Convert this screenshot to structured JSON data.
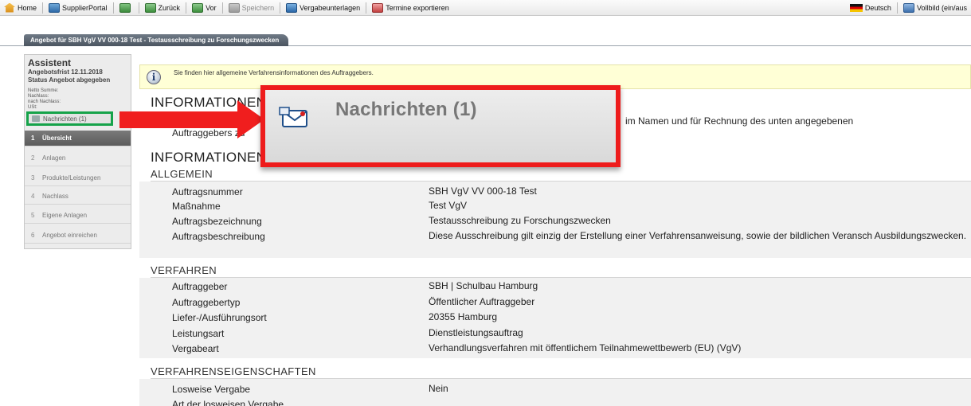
{
  "toolbar": {
    "home": "Home",
    "supplier_portal": "SupplierPortal",
    "back": "Zurück",
    "forward": "Vor",
    "save": "Speichern",
    "tender_documents": "Vergabeunterlagen",
    "export_dates": "Termine exportieren",
    "language": "Deutsch",
    "fullscreen": "Vollbild (ein/aus"
  },
  "tab": {
    "label": "Angebot für SBH VgV VV 000-18 Test - Testausschreibung zu Forschungszwecken"
  },
  "sidebar": {
    "title": "Assistent",
    "deadline": "Angebotsfrist 12.11.2018",
    "status": "Status Angebot abgegeben",
    "small_lines": [
      "Netto Summe:",
      "Nachlass:",
      "nach Nachlass:",
      "USt:"
    ],
    "messages": "Nachrichten (1)",
    "items": [
      {
        "num": "1",
        "label": "Übersicht"
      },
      {
        "num": "2",
        "label": "Anlagen"
      },
      {
        "num": "3",
        "label": "Produkte/Leistungen"
      },
      {
        "num": "4",
        "label": "Nachlass"
      },
      {
        "num": "5",
        "label": "Eigene Anlagen"
      },
      {
        "num": "6",
        "label": "Angebot einreichen"
      }
    ]
  },
  "info": {
    "text": "Sie finden hier allgemeine Verfahrensinformationen des Auftraggebers."
  },
  "main": {
    "heading1": "INFORMATIONEN",
    "intro_fragment1": "Auftraggebers zu",
    "intro_fragment2": "im Namen und für Rechnung des unten angegebenen",
    "heading2": "INFORMATIONEN",
    "sections": {
      "allgemein": {
        "title": "ALLGEMEIN",
        "rows": [
          {
            "label": "Auftragsnummer",
            "value": "SBH VgV VV 000-18 Test"
          },
          {
            "label": "Maßnahme",
            "value": "Test VgV"
          },
          {
            "label": "Auftragsbezeichnung",
            "value": "Testausschreibung zu Forschungszwecken"
          },
          {
            "label": "Auftragsbeschreibung",
            "value": "Diese Ausschreibung gilt einzig der Erstellung einer Verfahrensanweisung, sowie der bildlichen Veransch Ausbildungszwecken."
          }
        ]
      },
      "verfahren": {
        "title": "VERFAHREN",
        "rows": [
          {
            "label": "Auftraggeber",
            "value": "SBH | Schulbau Hamburg"
          },
          {
            "label": "Auftraggebertyp",
            "value": "Öffentlicher Auftraggeber"
          },
          {
            "label": "Liefer-/Ausführungsort",
            "value": "20355 Hamburg"
          },
          {
            "label": "Leistungsart",
            "value": "Dienstleistungsauftrag"
          },
          {
            "label": "Vergabeart",
            "value": "Verhandlungsverfahren mit öffentlichem Teilnahmewettbewerb (EU) (VgV)"
          }
        ]
      },
      "eigenschaften": {
        "title": "VERFAHRENSEIGENSCHAFTEN",
        "rows": [
          {
            "label": "Losweise Vergabe",
            "value": "Nein"
          }
        ],
        "partial_label": "Art der losweisen Vergabe"
      }
    }
  },
  "callout": {
    "label": "Nachrichten (1)",
    "color": "#ee1c1c",
    "highlight_color": "#16a34a"
  }
}
